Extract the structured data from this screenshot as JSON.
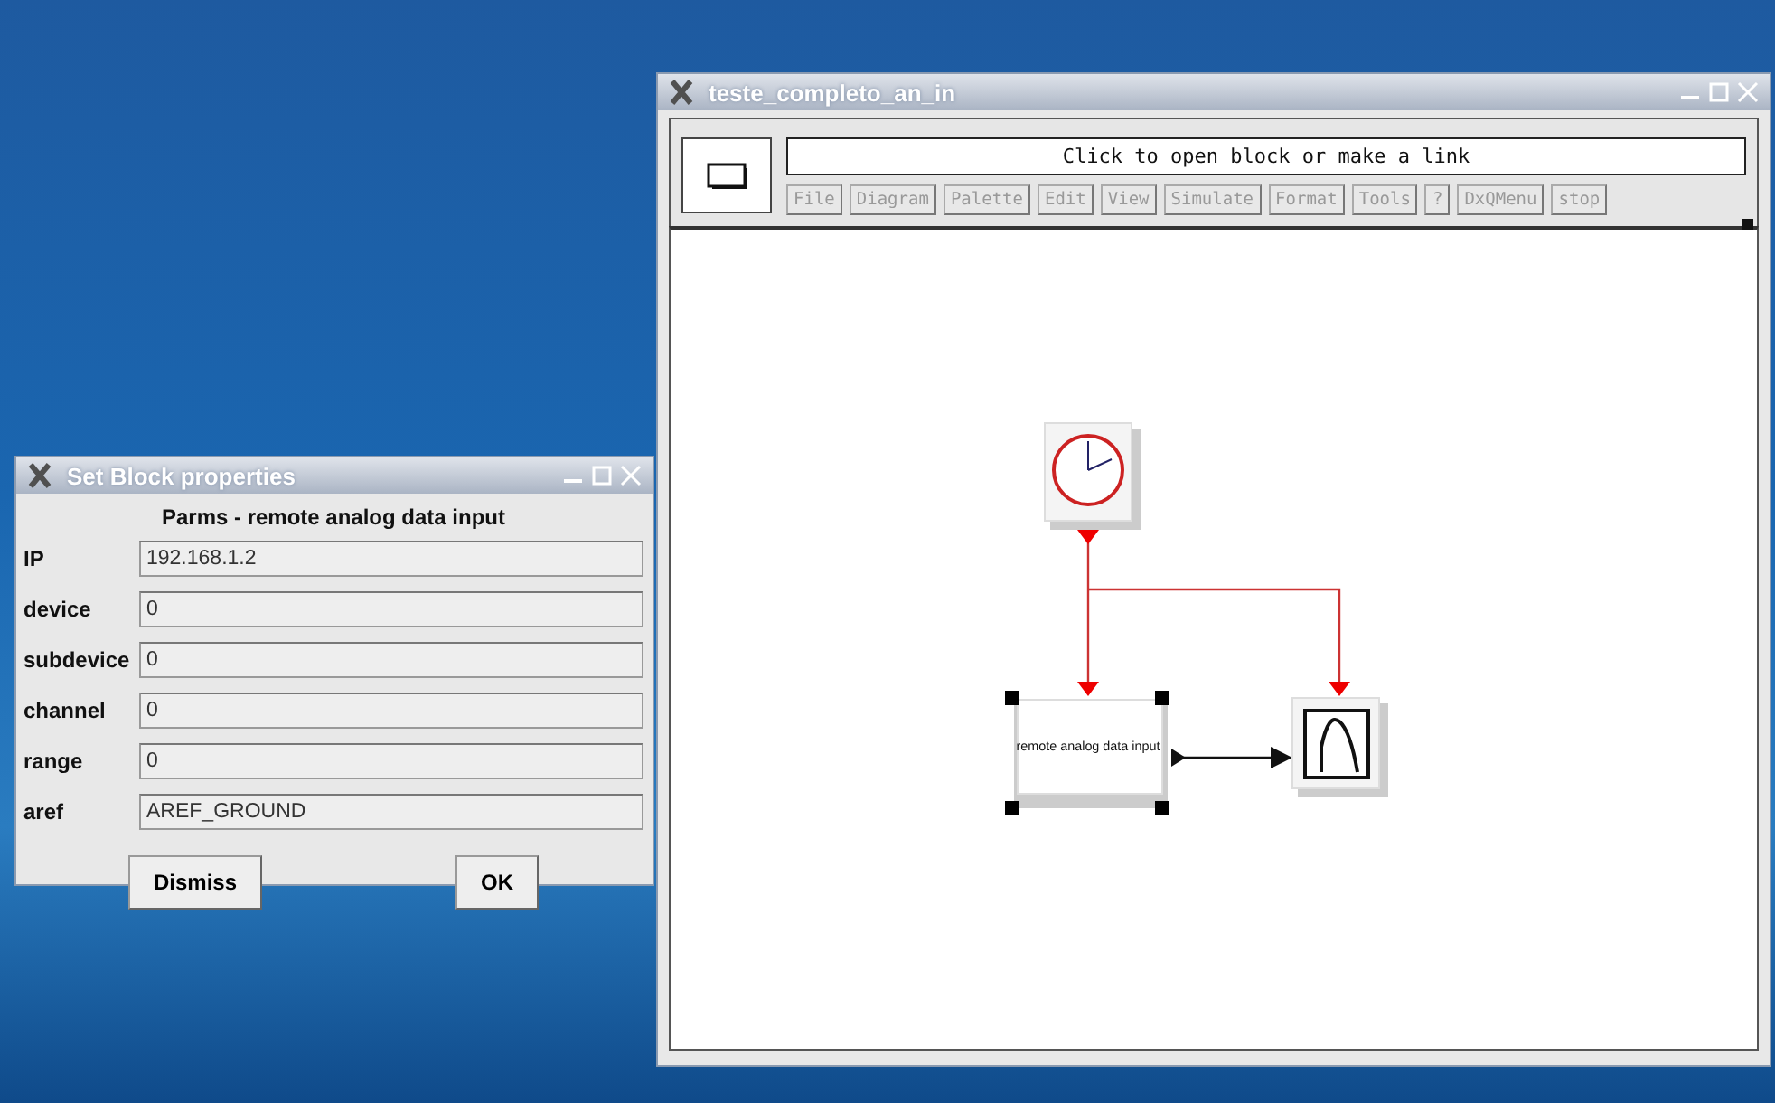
{
  "editor": {
    "title": "teste_completo_an_in",
    "message": "Click to open block or make a link",
    "menu": [
      {
        "label": "File",
        "disabled": true
      },
      {
        "label": "Diagram",
        "disabled": true
      },
      {
        "label": "Palette",
        "disabled": true
      },
      {
        "label": "Edit",
        "disabled": true
      },
      {
        "label": "View",
        "disabled": true
      },
      {
        "label": "Simulate",
        "disabled": true
      },
      {
        "label": "Format",
        "disabled": true
      },
      {
        "label": "Tools",
        "disabled": true
      },
      {
        "label": "?",
        "disabled": true
      },
      {
        "label": "DxQMenu",
        "disabled": true
      },
      {
        "label": "stop",
        "disabled": true
      }
    ],
    "blocks": [
      {
        "kind": "clock",
        "selected": false
      },
      {
        "kind": "text",
        "label": "remote analog data input",
        "selected": true
      },
      {
        "kind": "scope",
        "selected": false
      }
    ]
  },
  "dialog": {
    "title": "Set Block properties",
    "heading": "Parms - remote analog data input",
    "fields": [
      {
        "label": "IP",
        "value": "192.168.1.2"
      },
      {
        "label": "device",
        "value": "0"
      },
      {
        "label": "subdevice",
        "value": "0"
      },
      {
        "label": "channel",
        "value": "0"
      },
      {
        "label": "range",
        "value": "0"
      },
      {
        "label": "aref",
        "value": "AREF_GROUND"
      }
    ],
    "buttons": [
      "Dismiss",
      "OK"
    ]
  }
}
